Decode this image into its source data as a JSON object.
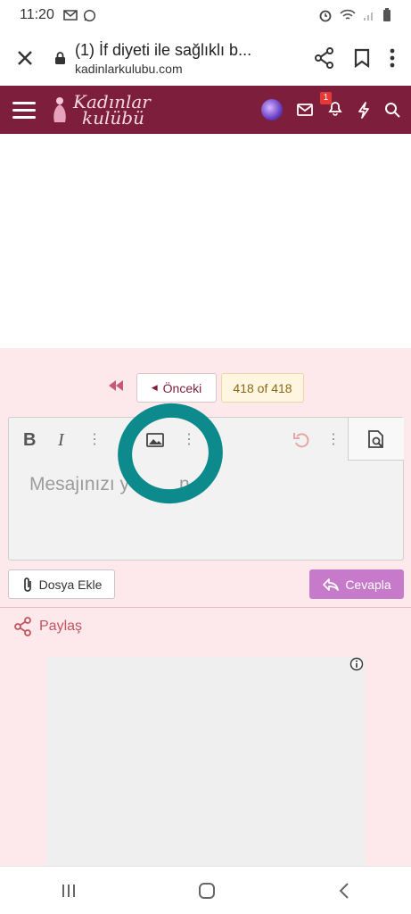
{
  "status_bar": {
    "time": "11:20",
    "left_icons": [
      "gmail-icon",
      "whatsapp-icon"
    ],
    "right_icons": [
      "alarm-icon",
      "wifi-icon",
      "signal-icon",
      "battery-icon"
    ]
  },
  "browser": {
    "page_title": "(1) İf diyeti ile sağlıklı b...",
    "url": "kadinlarkulubu.com",
    "icons": [
      "close-icon",
      "lock-icon",
      "share-icon",
      "bookmark-icon",
      "more-vert-icon"
    ]
  },
  "site_header": {
    "logo_line1": "Kadınlar",
    "logo_line2": "kulübü",
    "notification_count": "1",
    "brand_color": "#7d1e3c"
  },
  "pager": {
    "prev_label": "Önceki",
    "page_count": "418 of 418"
  },
  "editor": {
    "placeholder": "Mesajınızı y",
    "placeholder_tail": "n...",
    "toolbar": [
      "bold",
      "italic",
      "more",
      "image",
      "more",
      "undo",
      "more",
      "preview"
    ],
    "bold_label": "B",
    "italic_label": "I",
    "annotation_color": "#0d8a8c"
  },
  "actions": {
    "attach_label": "Dosya Ekle",
    "reply_label": "Cevapla",
    "reply_color": "#c67ac9"
  },
  "share": {
    "label": "Paylaş"
  }
}
